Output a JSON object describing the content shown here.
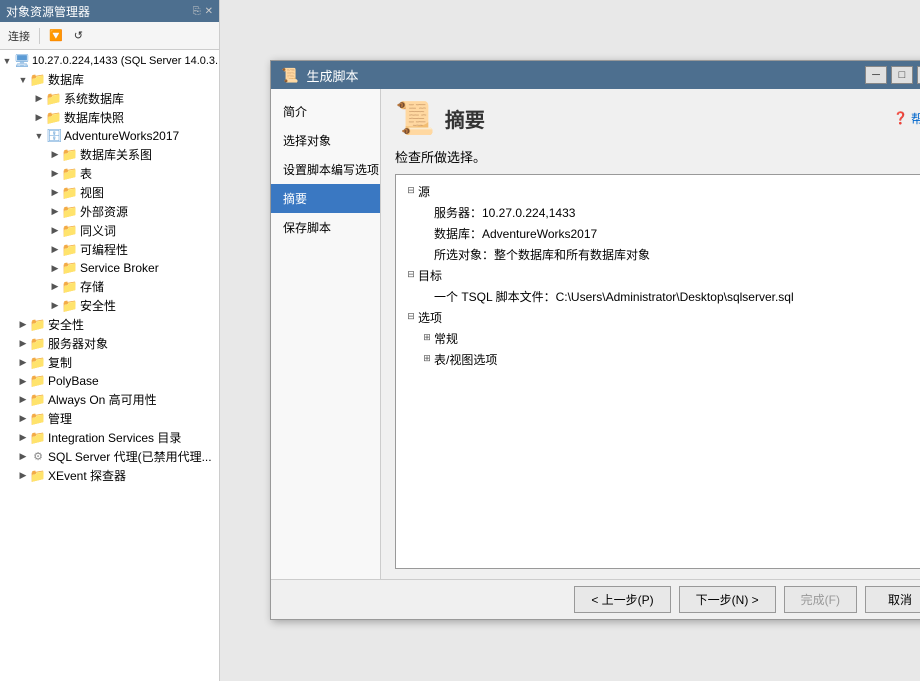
{
  "leftPanel": {
    "title": "对象资源管理器",
    "toolbar": {
      "connect_label": "连接",
      "refresh_icon": "↺"
    },
    "tree": [
      {
        "id": "server",
        "level": 0,
        "expanded": true,
        "icon": "server",
        "label": "10.27.0.224,1433 (SQL Server 14.0.3..."
      },
      {
        "id": "databases",
        "level": 1,
        "expanded": true,
        "icon": "folder",
        "label": "数据库"
      },
      {
        "id": "systemdb",
        "level": 2,
        "expanded": false,
        "icon": "folder",
        "label": "系统数据库"
      },
      {
        "id": "dbsnapshots",
        "level": 2,
        "expanded": false,
        "icon": "folder",
        "label": "数据库快照"
      },
      {
        "id": "adventureworks",
        "level": 2,
        "expanded": true,
        "icon": "db",
        "label": "AdventureWorks2017"
      },
      {
        "id": "dbdiagrams",
        "level": 3,
        "expanded": false,
        "icon": "folder",
        "label": "数据库关系图"
      },
      {
        "id": "tables",
        "level": 3,
        "expanded": false,
        "icon": "folder",
        "label": "表"
      },
      {
        "id": "views",
        "level": 3,
        "expanded": false,
        "icon": "folder",
        "label": "视图"
      },
      {
        "id": "externalresources",
        "level": 3,
        "expanded": false,
        "icon": "folder",
        "label": "外部资源"
      },
      {
        "id": "synonyms",
        "level": 3,
        "expanded": false,
        "icon": "folder",
        "label": "同义词"
      },
      {
        "id": "programmability",
        "level": 3,
        "expanded": false,
        "icon": "folder",
        "label": "可编程性"
      },
      {
        "id": "servicebroker",
        "level": 3,
        "expanded": false,
        "icon": "folder",
        "label": "Service Broker"
      },
      {
        "id": "storage",
        "level": 3,
        "expanded": false,
        "icon": "folder",
        "label": "存储"
      },
      {
        "id": "security",
        "level": 3,
        "expanded": false,
        "icon": "folder",
        "label": "安全性"
      },
      {
        "id": "security2",
        "level": 1,
        "expanded": false,
        "icon": "folder",
        "label": "安全性"
      },
      {
        "id": "serverobj",
        "level": 1,
        "expanded": false,
        "icon": "folder",
        "label": "服务器对象"
      },
      {
        "id": "replication",
        "level": 1,
        "expanded": false,
        "icon": "folder",
        "label": "复制"
      },
      {
        "id": "polybase",
        "level": 1,
        "expanded": false,
        "icon": "folder",
        "label": "PolyBase"
      },
      {
        "id": "alwayson",
        "level": 1,
        "expanded": false,
        "icon": "folder",
        "label": "Always On 高可用性"
      },
      {
        "id": "manage",
        "level": 1,
        "expanded": false,
        "icon": "folder",
        "label": "管理"
      },
      {
        "id": "integration",
        "level": 1,
        "expanded": false,
        "icon": "folder",
        "label": "Integration Services 目录"
      },
      {
        "id": "sqlagent",
        "level": 1,
        "expanded": false,
        "icon": "special",
        "label": "SQL Server 代理(已禁用代理..."
      },
      {
        "id": "xevent",
        "level": 1,
        "expanded": false,
        "icon": "folder",
        "label": "XEvent 探查器"
      }
    ]
  },
  "dialog": {
    "title": "生成脚本",
    "nav": [
      {
        "id": "intro",
        "label": "简介"
      },
      {
        "id": "choose",
        "label": "选择对象"
      },
      {
        "id": "scripting",
        "label": "设置脚本编写选项"
      },
      {
        "id": "summary",
        "label": "摘要",
        "active": true
      },
      {
        "id": "save",
        "label": "保存脚本"
      }
    ],
    "page_title": "摘要",
    "help_label": "帮助",
    "check_title": "检查所做选择。",
    "summary_tree": [
      {
        "id": "source",
        "level": 0,
        "expanded": true,
        "label": "源",
        "value": ""
      },
      {
        "id": "server_val",
        "level": 1,
        "expanded": false,
        "label": "服务器：10.27.0.224,1433",
        "value": ""
      },
      {
        "id": "database_val",
        "level": 1,
        "expanded": false,
        "label": "数据库：AdventureWorks2017",
        "value": ""
      },
      {
        "id": "objects_val",
        "level": 1,
        "expanded": false,
        "label": "所选对象：整个数据库和所有数据库对象",
        "value": ""
      },
      {
        "id": "target",
        "level": 0,
        "expanded": true,
        "label": "目标",
        "value": ""
      },
      {
        "id": "script_val",
        "level": 1,
        "expanded": false,
        "label": "一个 TSQL 脚本文件：C:\\Users\\Administrator\\Desktop\\sqlserver.sql",
        "value": ""
      },
      {
        "id": "options",
        "level": 0,
        "expanded": true,
        "label": "选项",
        "value": ""
      },
      {
        "id": "general",
        "level": 1,
        "expanded": false,
        "label": "常规",
        "value": ""
      },
      {
        "id": "tableview",
        "level": 1,
        "expanded": false,
        "label": "表/视图选项",
        "value": ""
      }
    ],
    "footer": {
      "prev_label": "< 上一步(P)",
      "next_label": "下一步(N) >",
      "finish_label": "完成(F)",
      "cancel_label": "取消"
    }
  }
}
